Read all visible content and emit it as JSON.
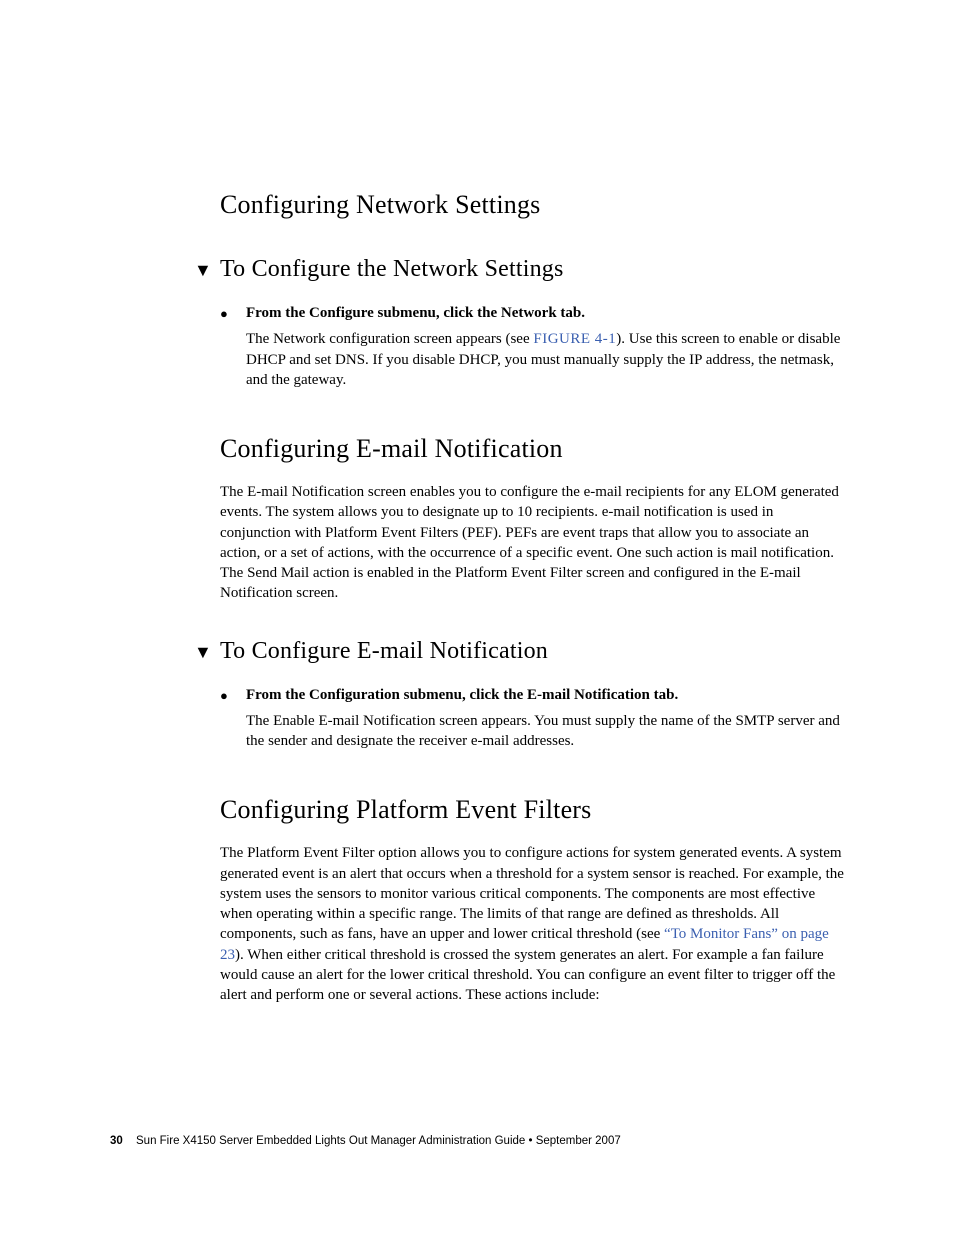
{
  "sections": {
    "net": {
      "heading": "Configuring Network Settings",
      "proc": {
        "heading": "To Configure the Network Settings",
        "step": "From the Configure submenu, click the Network tab.",
        "body_a": "The Network configuration screen appears (see ",
        "figref": "FIGURE 4-1",
        "body_b": "). Use this screen to enable or disable DHCP and set DNS. If you disable DHCP, you must manually supply the IP address, the netmask, and the gateway."
      }
    },
    "mail": {
      "heading": "Configuring E-mail Notification",
      "para": "The E-mail Notification screen enables you to configure the e-mail recipients for any ELOM generated events. The system allows you to designate up to 10 recipients. e-mail notification is used in conjunction with Platform Event Filters (PEF). PEFs are event traps that allow you to associate an action, or a set of actions, with the occurrence of a specific event. One such action is mail notification. The Send Mail action is enabled in the Platform Event Filter screen and configured in the E-mail Notification screen.",
      "proc": {
        "heading": "To Configure E-mail Notification",
        "step": "From the Configuration submenu, click the E-mail Notification tab.",
        "body": "The Enable E-mail Notification screen appears. You must supply the name of the SMTP server and the sender and designate the receiver e-mail addresses."
      }
    },
    "pef": {
      "heading": "Configuring Platform Event Filters",
      "para_a": "The Platform Event Filter option allows you to configure actions for system generated events. A system generated event is an alert that occurs when a threshold for a system sensor is reached. For example, the system uses the sensors to monitor various critical components. The components are most effective when operating within a specific range. The limits of that range are defined as thresholds. All components, such as fans, have an upper and lower critical threshold (see ",
      "link": "“To Monitor Fans” on page 23",
      "para_b": "). When either critical threshold is crossed the system generates an alert. For example a fan failure would cause an alert for the lower critical threshold. You can configure an event filter to trigger off the alert and perform one or several actions. These actions include:"
    }
  },
  "footer": {
    "page": "30",
    "title": "Sun Fire X4150 Server Embedded Lights Out Manager Administration Guide • September 2007"
  }
}
